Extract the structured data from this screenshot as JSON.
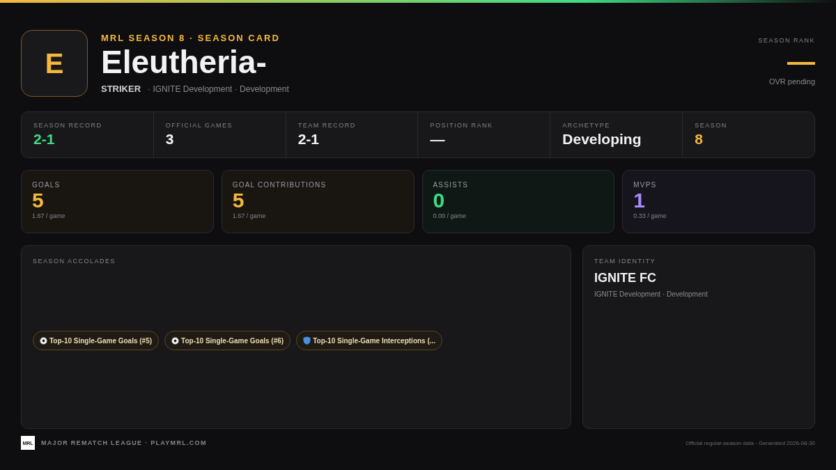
{
  "header": {
    "avatar_letter": "E",
    "eyebrow": "MRL SEASON 8 · SEASON CARD",
    "name": "Eleutheria-",
    "position": "STRIKER",
    "team_line": "· IGNITE Development · Development"
  },
  "season_rank": {
    "label": "SEASON RANK",
    "value": "—",
    "note": "OVR pending"
  },
  "summary": [
    {
      "label": "SEASON RECORD",
      "value": "2-1",
      "color": "#3ddc84"
    },
    {
      "label": "OFFICIAL GAMES",
      "value": "3",
      "color": "#f2f2f2"
    },
    {
      "label": "TEAM RECORD",
      "value": "2-1",
      "color": "#f2f2f2"
    },
    {
      "label": "POSITION RANK",
      "value": "—",
      "color": "#f2f2f2"
    },
    {
      "label": "ARCHETYPE",
      "value": "Developing",
      "color": "#f2f2f2"
    },
    {
      "label": "SEASON",
      "value": "8",
      "color": "#f5b83d"
    }
  ],
  "stats": [
    {
      "label": "GOALS",
      "value": "5",
      "per_game": "1.67 / game",
      "color": "#f5b83d"
    },
    {
      "label": "GOAL CONTRIBUTIONS",
      "value": "5",
      "per_game": "1.67 / game",
      "color": "#f5b83d"
    },
    {
      "label": "ASSISTS",
      "value": "0",
      "per_game": "0.00 / game",
      "color": "#3ddc84"
    },
    {
      "label": "MVPS",
      "value": "1",
      "per_game": "0.33 / game",
      "color": "#a78bfa"
    }
  ],
  "accolades": {
    "title": "SEASON ACCOLADES",
    "items": [
      {
        "kind": "goals",
        "label": "Top-10 Single-Game Goals (#5)"
      },
      {
        "kind": "goals",
        "label": "Top-10 Single-Game Goals (#6)"
      },
      {
        "kind": "interceptions",
        "label": "Top-10 Single-Game Interceptions (..."
      }
    ]
  },
  "team_identity": {
    "title": "TEAM IDENTITY",
    "name": "IGNITE FC",
    "sub": "IGNITE Development · Development"
  },
  "footer": {
    "logo_text": "MRL",
    "league": "MAJOR REMATCH LEAGUE · PLAYMRL.COM",
    "note": "Official regular-season data · Generated 2026-08-30"
  }
}
